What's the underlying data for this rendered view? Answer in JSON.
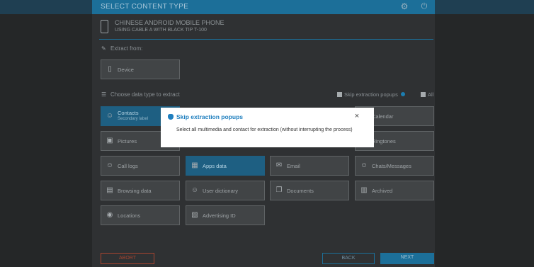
{
  "header": {
    "title": "SELECT CONTENT TYPE",
    "icons": [
      "gear-icon",
      "power-icon"
    ]
  },
  "device": {
    "name": "CHINESE ANDROID MOBILE PHONE",
    "subtitle": "USING CABLE A WITH BLACK TIP T-100",
    "icon": "phone-icon"
  },
  "extract_from": {
    "label": "Extract from:",
    "source": "Device"
  },
  "choose": {
    "label": "Choose  data type to extract",
    "skip_popups_label": "Skip extraction popups",
    "all_label": "All"
  },
  "tiles": [
    {
      "label": "Contacts",
      "sub": "Secondary label",
      "icon": "contacts-icon",
      "selected": true
    },
    {
      "label": "Calendar",
      "icon": "calendar-icon"
    },
    {
      "label": "Pictures",
      "icon": "pictures-icon"
    },
    {
      "label": "Ringtones",
      "icon": "ringtones-icon"
    },
    {
      "label": "Call logs",
      "icon": "call-logs-icon"
    },
    {
      "label": "Apps data",
      "icon": "apps-grid-icon",
      "selected": true
    },
    {
      "label": "Email",
      "icon": "email-icon"
    },
    {
      "label": "Chats/Messages",
      "icon": "chats-icon"
    },
    {
      "label": "Browsing data",
      "icon": "browsing-icon"
    },
    {
      "label": "User dictionary",
      "icon": "dictionary-icon"
    },
    {
      "label": "Documents",
      "icon": "documents-icon"
    },
    {
      "label": "Archived",
      "icon": "archive-icon"
    },
    {
      "label": "Locations",
      "icon": "location-icon"
    },
    {
      "label": "Advertising ID",
      "icon": "advertising-icon"
    }
  ],
  "footer": {
    "abort": "ABORT",
    "back": "BACK",
    "next": "NEXT"
  },
  "modal": {
    "title": "Skip extraction popups",
    "text": "Select all multimedia and contact for extraction (without interrupting the process)",
    "close": "×"
  },
  "colors": {
    "accent": "#1c6f99",
    "abort": "#a8442f",
    "modal_title": "#1f7fbf"
  }
}
